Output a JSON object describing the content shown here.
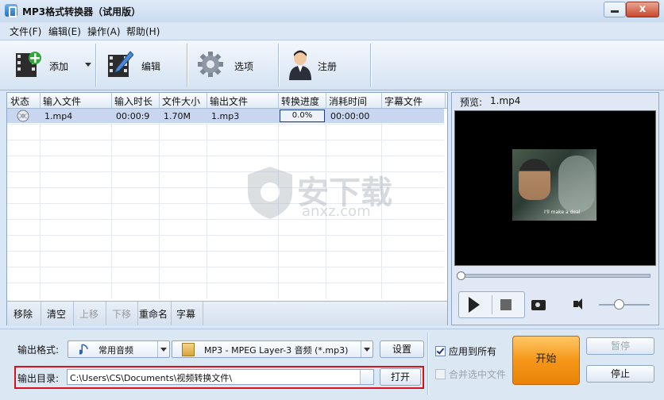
{
  "window": {
    "title": "MP3格式转换器（试用版）",
    "close_label": "x"
  },
  "menu": [
    "文件(F)",
    "编辑(E)",
    "操作(A)",
    "帮助(H)"
  ],
  "toolbar": {
    "add": "添加",
    "edit": "编辑",
    "options": "选项",
    "register": "注册"
  },
  "table": {
    "columns": [
      "状态",
      "输入文件",
      "输入时长",
      "文件大小",
      "输出文件",
      "转换进度",
      "消耗时间",
      "字幕文件"
    ],
    "rows": [
      {
        "status_icon": "disc-icon",
        "input": "1.mp4",
        "duration": "00:00:9",
        "size": "1.70M",
        "output": "1.mp3",
        "progress": "0.0%",
        "elapsed": "00:00:00",
        "subtitle": ""
      }
    ]
  },
  "list_actions": {
    "remove": "移除",
    "clear": "清空",
    "up": "上移",
    "down": "下移",
    "rename": "重命名",
    "subtitle": "字幕"
  },
  "preview": {
    "label": "预览:",
    "file": "1.mp4",
    "video_caption": "I'll make a deal"
  },
  "output": {
    "format_label": "输出格式:",
    "format_category": "常用音频",
    "format_value": "MP3 - MPEG Layer-3 音频 (*.mp3)",
    "settings": "设置",
    "dir_label": "输出目录:",
    "dir_value": "C:\\Users\\CS\\Documents\\视频转换文件\\",
    "open": "打开"
  },
  "options": {
    "apply_all": "应用到所有",
    "apply_all_checked": true,
    "merge": "合并选中文件",
    "merge_checked": false
  },
  "actions": {
    "start": "开始",
    "pause": "暂停",
    "stop": "停止"
  },
  "watermark": {
    "text": "安下载",
    "sub": "anxz.com"
  },
  "colors": {
    "accent_orange": "#f59718",
    "highlight_red": "#d4141a",
    "row_selected": "#c8d7ef"
  }
}
